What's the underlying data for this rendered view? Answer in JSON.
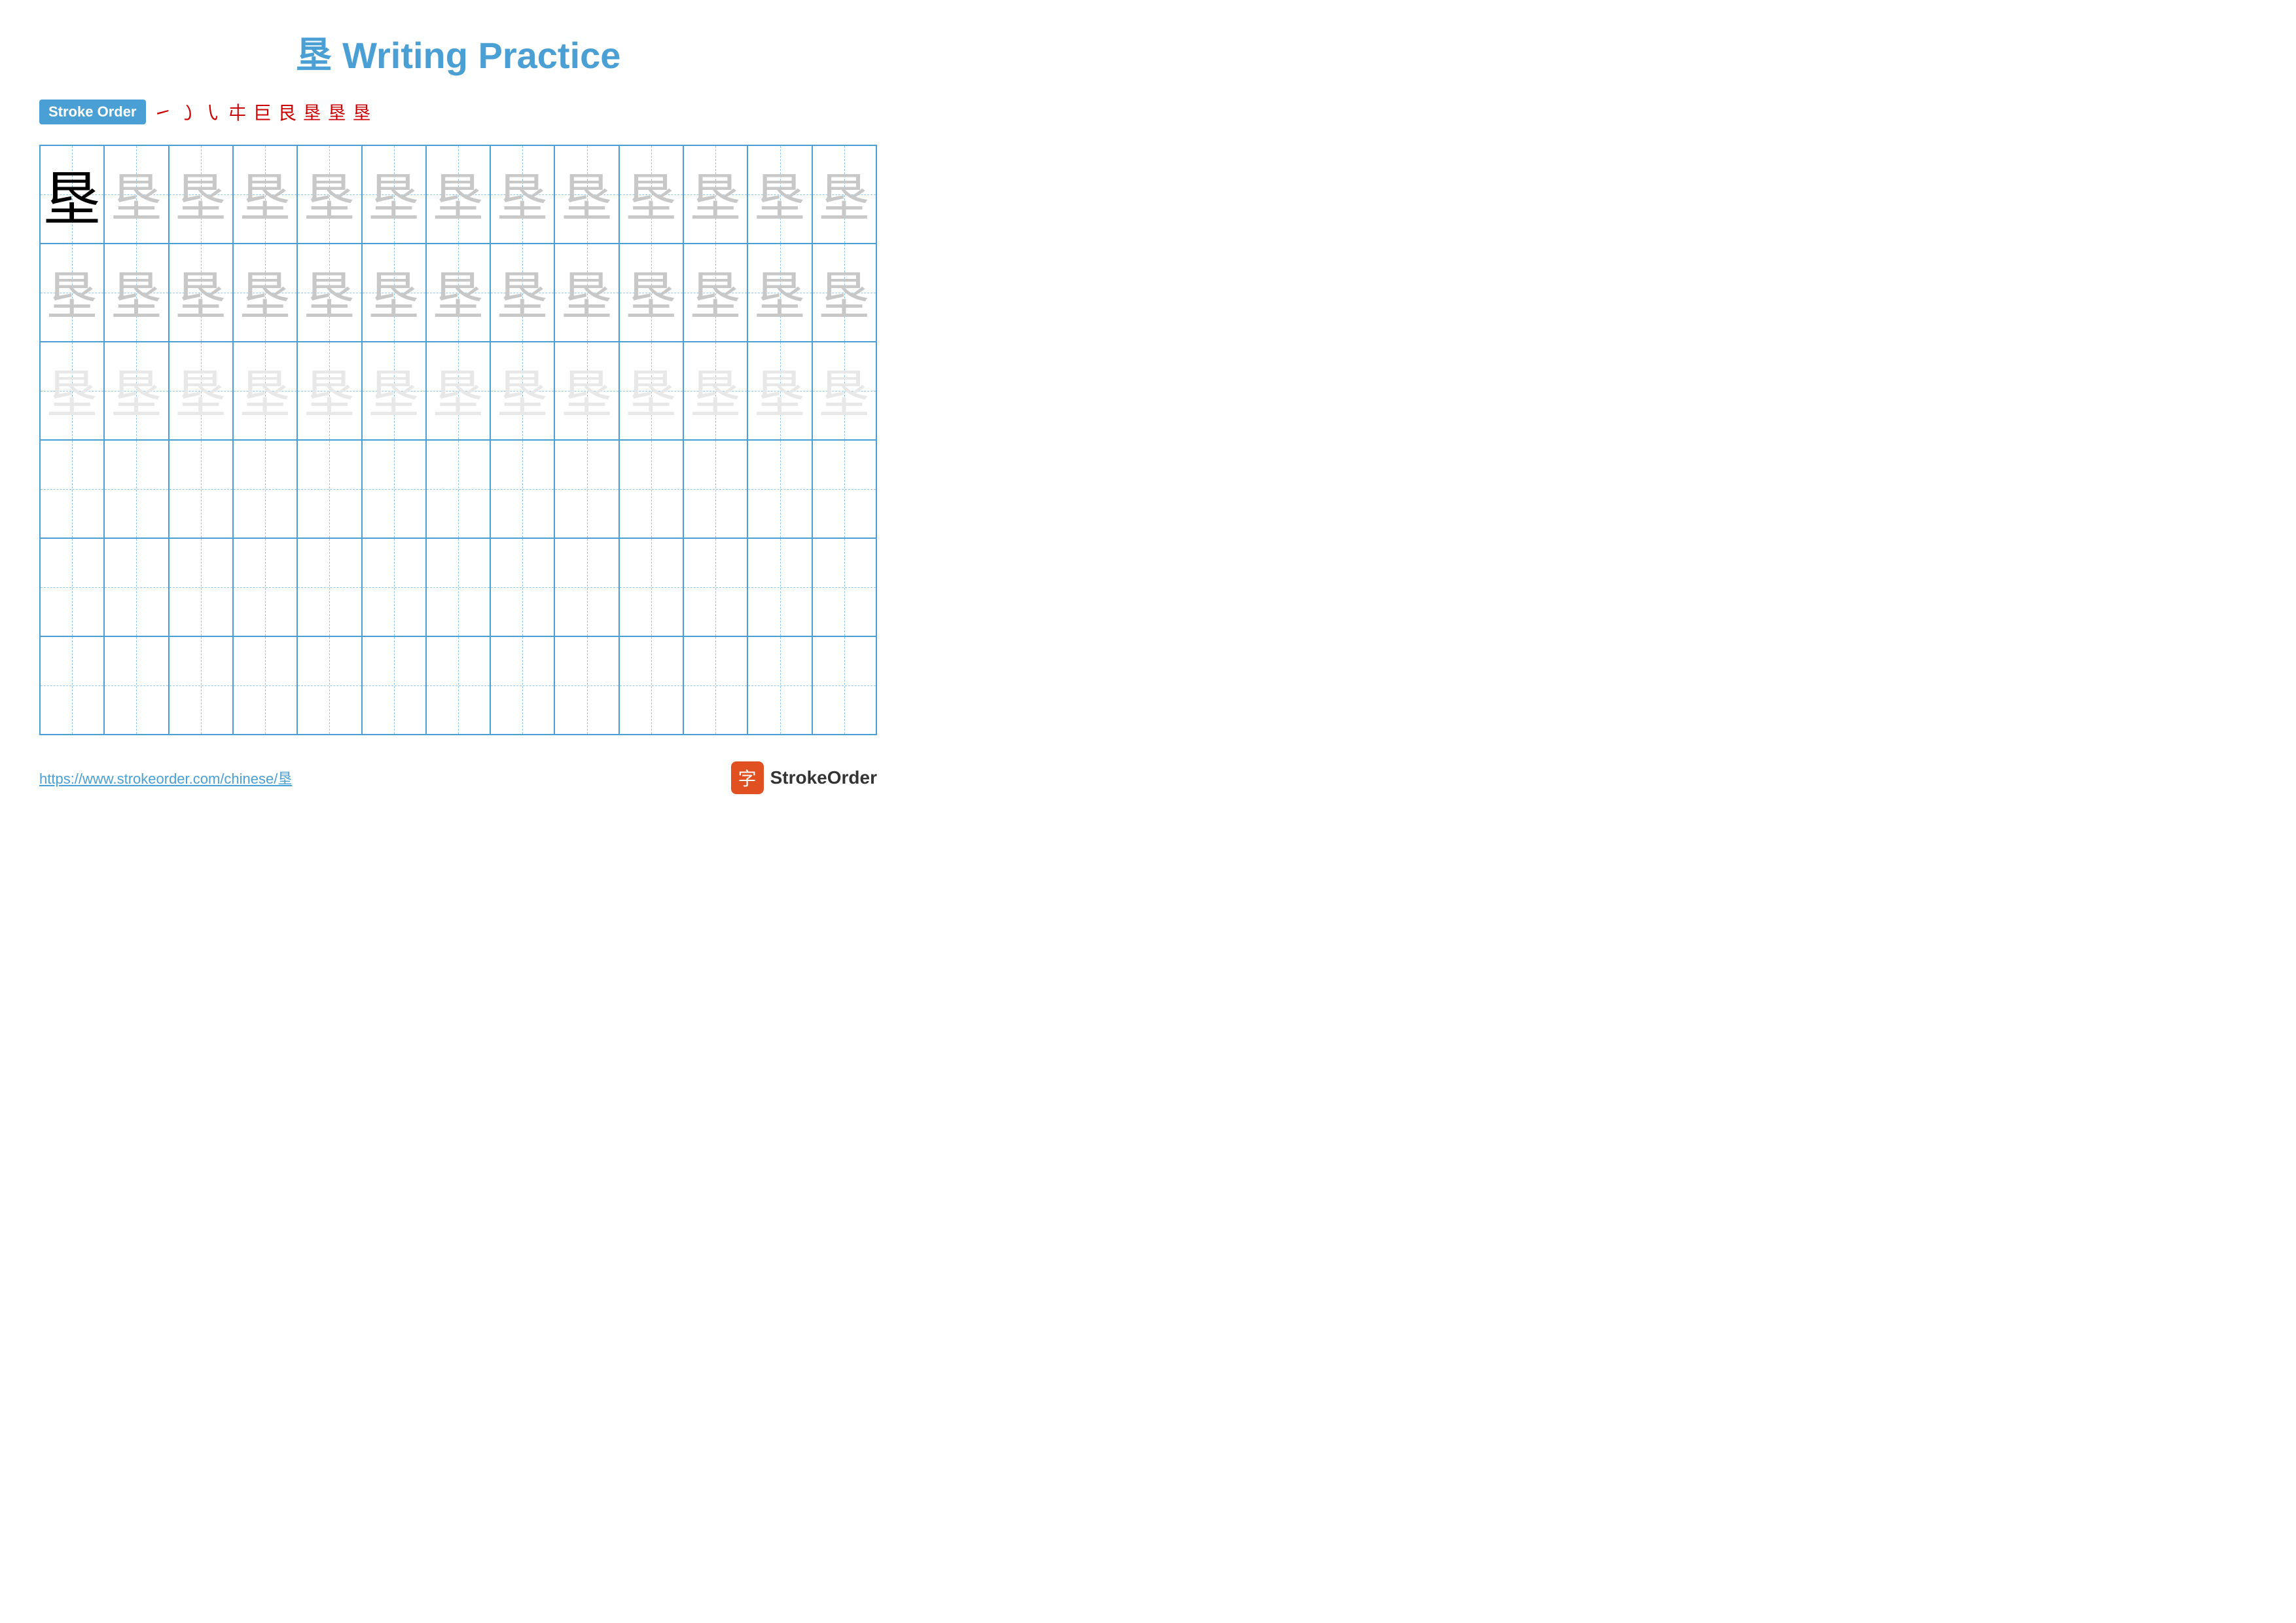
{
  "title": {
    "character": "垦",
    "label": "Writing Practice",
    "full": "垦 Writing Practice"
  },
  "stroke_order": {
    "badge_label": "Stroke Order",
    "strokes": [
      "㇀",
      "㇁",
      "㇂",
      "㐄",
      "㔾",
      "㔿",
      "垦1",
      "垦2",
      "垦"
    ]
  },
  "grid": {
    "rows": 6,
    "cols": 13,
    "character": "垦"
  },
  "footer": {
    "url": "https://www.strokeorder.com/chinese/垦",
    "logo_char": "字",
    "logo_text": "StrokeOrder"
  },
  "colors": {
    "blue": "#4a9fd4",
    "red": "#cc0000",
    "badge_bg": "#4a9fd4",
    "badge_text": "#ffffff"
  }
}
